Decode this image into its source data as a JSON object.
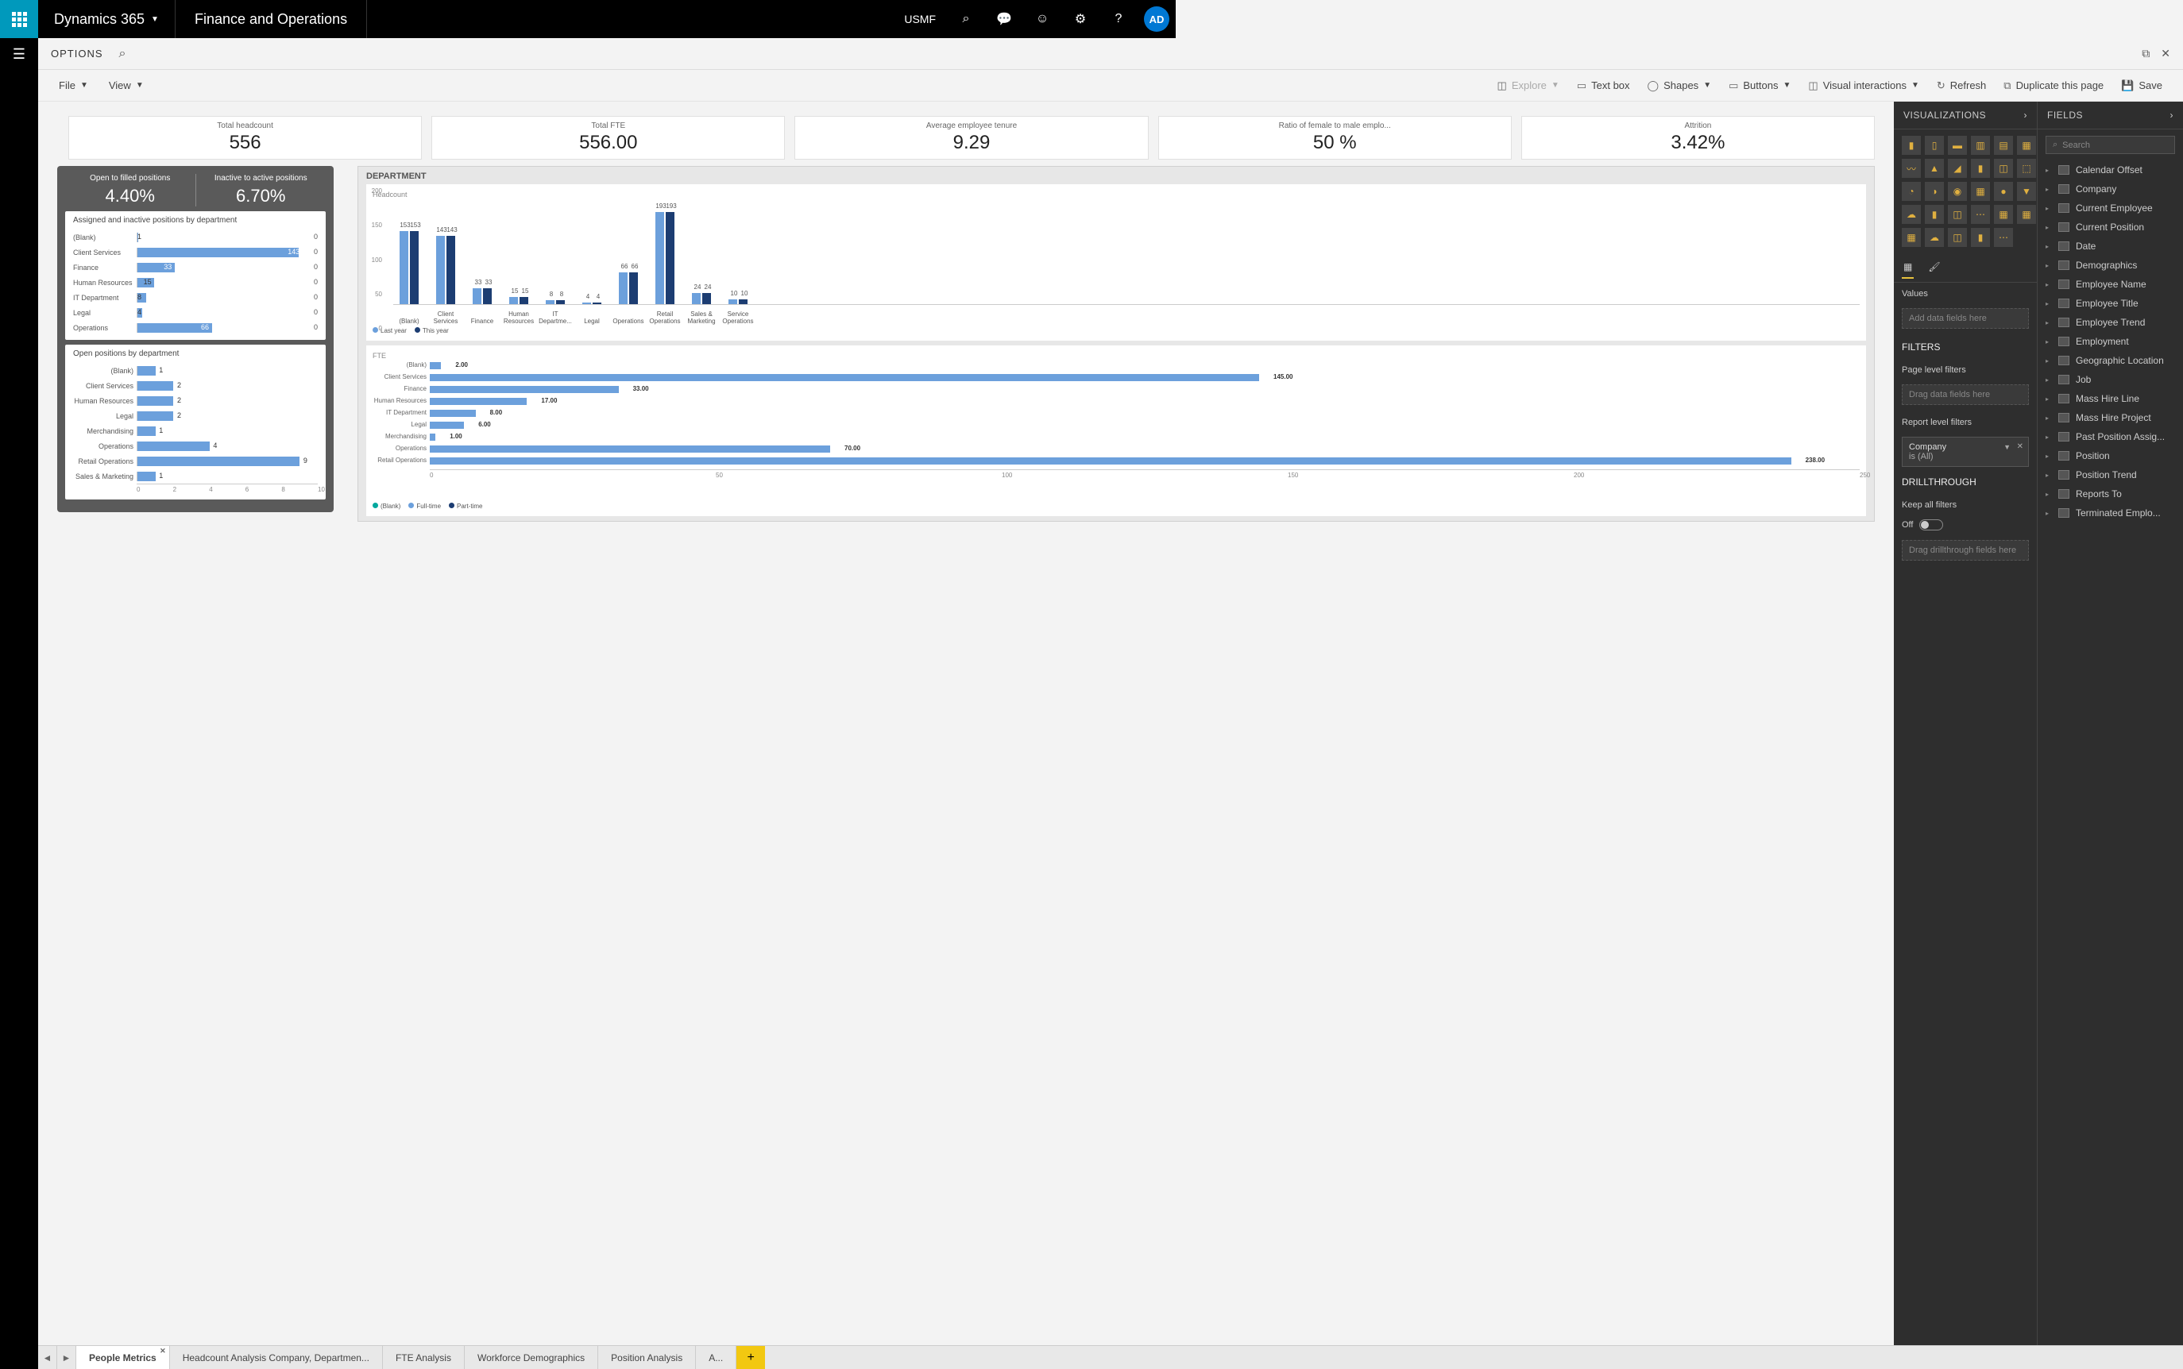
{
  "topbar": {
    "product": "Dynamics 365",
    "module": "Finance and Operations",
    "company": "USMF",
    "avatar": "AD"
  },
  "optionsbar": {
    "label": "OPTIONS"
  },
  "report_toolbar": {
    "file": "File",
    "view": "View",
    "explore": "Explore",
    "textbox": "Text box",
    "shapes": "Shapes",
    "buttons": "Buttons",
    "visual_interactions": "Visual interactions",
    "refresh": "Refresh",
    "duplicate": "Duplicate this page",
    "save": "Save"
  },
  "kpis": [
    {
      "label": "Total headcount",
      "value": "556"
    },
    {
      "label": "Total FTE",
      "value": "556.00"
    },
    {
      "label": "Average employee tenure",
      "value": "9.29"
    },
    {
      "label": "Ratio of female to male emplo...",
      "value": "50 %"
    },
    {
      "label": "Attrition",
      "value": "3.42%"
    }
  ],
  "darkblock": {
    "left": {
      "label": "Open to filled positions",
      "value": "4.40%"
    },
    "right": {
      "label": "Inactive to active positions",
      "value": "6.70%"
    }
  },
  "assigned_chart": {
    "title": "Assigned and inactive positions by department",
    "rows": [
      {
        "cat": "(Blank)",
        "v1": 1,
        "v2": 0
      },
      {
        "cat": "Client Services",
        "v1": 143,
        "v2": 0
      },
      {
        "cat": "Finance",
        "v1": 33,
        "v2": 0
      },
      {
        "cat": "Human Resources",
        "v1": 15,
        "v2": 0
      },
      {
        "cat": "IT Department",
        "v1": 8,
        "v2": 0
      },
      {
        "cat": "Legal",
        "v1": 4,
        "v2": 0
      },
      {
        "cat": "Operations",
        "v1": 66,
        "v2": 0
      }
    ]
  },
  "open_chart": {
    "title": "Open positions by department",
    "rows": [
      {
        "cat": "(Blank)",
        "v": 1
      },
      {
        "cat": "Client Services",
        "v": 2
      },
      {
        "cat": "Human Resources",
        "v": 2
      },
      {
        "cat": "Legal",
        "v": 2
      },
      {
        "cat": "Merchandising",
        "v": 1
      },
      {
        "cat": "Operations",
        "v": 4
      },
      {
        "cat": "Retail Operations",
        "v": 9
      },
      {
        "cat": "Sales & Marketing",
        "v": 1
      }
    ],
    "xticks": [
      "0",
      "2",
      "4",
      "6",
      "8",
      "10"
    ]
  },
  "department_block": {
    "title": "DEPARTMENT",
    "headcount": {
      "title": "Headcount",
      "yticks": [
        "200",
        "150",
        "100",
        "50",
        "0"
      ],
      "cats": [
        "(Blank)",
        "Client Services",
        "Finance",
        "Human Resources",
        "IT Departme...",
        "Legal",
        "Operations",
        "Retail Operations",
        "Sales & Marketing",
        "Service Operations"
      ],
      "last_year": [
        153,
        143,
        33,
        15,
        8,
        4,
        66,
        193,
        24,
        10
      ],
      "this_year": [
        153,
        143,
        33,
        15,
        8,
        4,
        66,
        193,
        24,
        10
      ],
      "legend": [
        "Last year",
        "This year"
      ]
    },
    "fte": {
      "title": "FTE",
      "rows": [
        {
          "cat": "(Blank)",
          "v": 2.0
        },
        {
          "cat": "Client Services",
          "v": 145.0
        },
        {
          "cat": "Finance",
          "v": 33.0
        },
        {
          "cat": "Human Resources",
          "v": 17.0
        },
        {
          "cat": "IT Department",
          "v": 8.0
        },
        {
          "cat": "Legal",
          "v": 6.0
        },
        {
          "cat": "Merchandising",
          "v": 1.0
        },
        {
          "cat": "Operations",
          "v": 70.0
        },
        {
          "cat": "Retail Operations",
          "v": 238.0,
          "pt": 1.0
        }
      ],
      "xticks": [
        "0",
        "50",
        "100",
        "150",
        "200",
        "250"
      ],
      "legend": [
        "(Blank)",
        "Full-time",
        "Part-time"
      ]
    }
  },
  "viz_panel": {
    "title": "VISUALIZATIONS",
    "values_label": "Values",
    "values_placeholder": "Add data fields here",
    "filters_title": "FILTERS",
    "page_filters": "Page level filters",
    "page_filters_placeholder": "Drag data fields here",
    "report_filters": "Report level filters",
    "filter_name": "Company",
    "filter_value": "is (All)",
    "drillthrough_title": "DRILLTHROUGH",
    "keep_all": "Keep all filters",
    "off": "Off",
    "drill_placeholder": "Drag drillthrough fields here"
  },
  "fields_panel": {
    "title": "FIELDS",
    "search_placeholder": "Search",
    "items": [
      "Calendar Offset",
      "Company",
      "Current Employee",
      "Current Position",
      "Date",
      "Demographics",
      "Employee Name",
      "Employee Title",
      "Employee Trend",
      "Employment",
      "Geographic Location",
      "Job",
      "Mass Hire Line",
      "Mass Hire Project",
      "Past Position Assig...",
      "Position",
      "Position Trend",
      "Reports To",
      "Terminated Emplo..."
    ]
  },
  "page_tabs": {
    "tabs": [
      "People Metrics",
      "Headcount Analysis Company, Departmen...",
      "FTE Analysis",
      "Workforce Demographics",
      "Position Analysis",
      "A..."
    ],
    "active": 0
  },
  "chart_data": [
    {
      "type": "bar",
      "orientation": "horizontal",
      "title": "Assigned and inactive positions by department",
      "categories": [
        "(Blank)",
        "Client Services",
        "Finance",
        "Human Resources",
        "IT Department",
        "Legal",
        "Operations"
      ],
      "series": [
        {
          "name": "Assigned",
          "values": [
            1,
            143,
            33,
            15,
            8,
            4,
            66
          ]
        },
        {
          "name": "Inactive",
          "values": [
            0,
            0,
            0,
            0,
            0,
            0,
            0
          ]
        }
      ]
    },
    {
      "type": "bar",
      "orientation": "horizontal",
      "title": "Open positions by department",
      "categories": [
        "(Blank)",
        "Client Services",
        "Human Resources",
        "Legal",
        "Merchandising",
        "Operations",
        "Retail Operations",
        "Sales & Marketing"
      ],
      "values": [
        1,
        2,
        2,
        2,
        1,
        4,
        9,
        1
      ],
      "xlim": [
        0,
        10
      ]
    },
    {
      "type": "bar",
      "title": "Headcount",
      "categories": [
        "(Blank)",
        "Client Services",
        "Finance",
        "Human Resources",
        "IT Department",
        "Legal",
        "Operations",
        "Retail Operations",
        "Sales & Marketing",
        "Service Operations"
      ],
      "series": [
        {
          "name": "Last year",
          "values": [
            153,
            143,
            33,
            15,
            8,
            4,
            66,
            193,
            24,
            10
          ]
        },
        {
          "name": "This year",
          "values": [
            153,
            143,
            33,
            15,
            8,
            4,
            66,
            193,
            24,
            10
          ]
        }
      ],
      "ylim": [
        0,
        200
      ]
    },
    {
      "type": "bar",
      "orientation": "horizontal",
      "title": "FTE",
      "categories": [
        "(Blank)",
        "Client Services",
        "Finance",
        "Human Resources",
        "IT Department",
        "Legal",
        "Merchandising",
        "Operations",
        "Retail Operations"
      ],
      "series": [
        {
          "name": "Full-time",
          "values": [
            2,
            145,
            33,
            17,
            8,
            6,
            1,
            70,
            238
          ]
        },
        {
          "name": "Part-time",
          "values": [
            0,
            0,
            0,
            0,
            0,
            0,
            0,
            0,
            1
          ]
        }
      ],
      "xlim": [
        0,
        250
      ]
    }
  ]
}
